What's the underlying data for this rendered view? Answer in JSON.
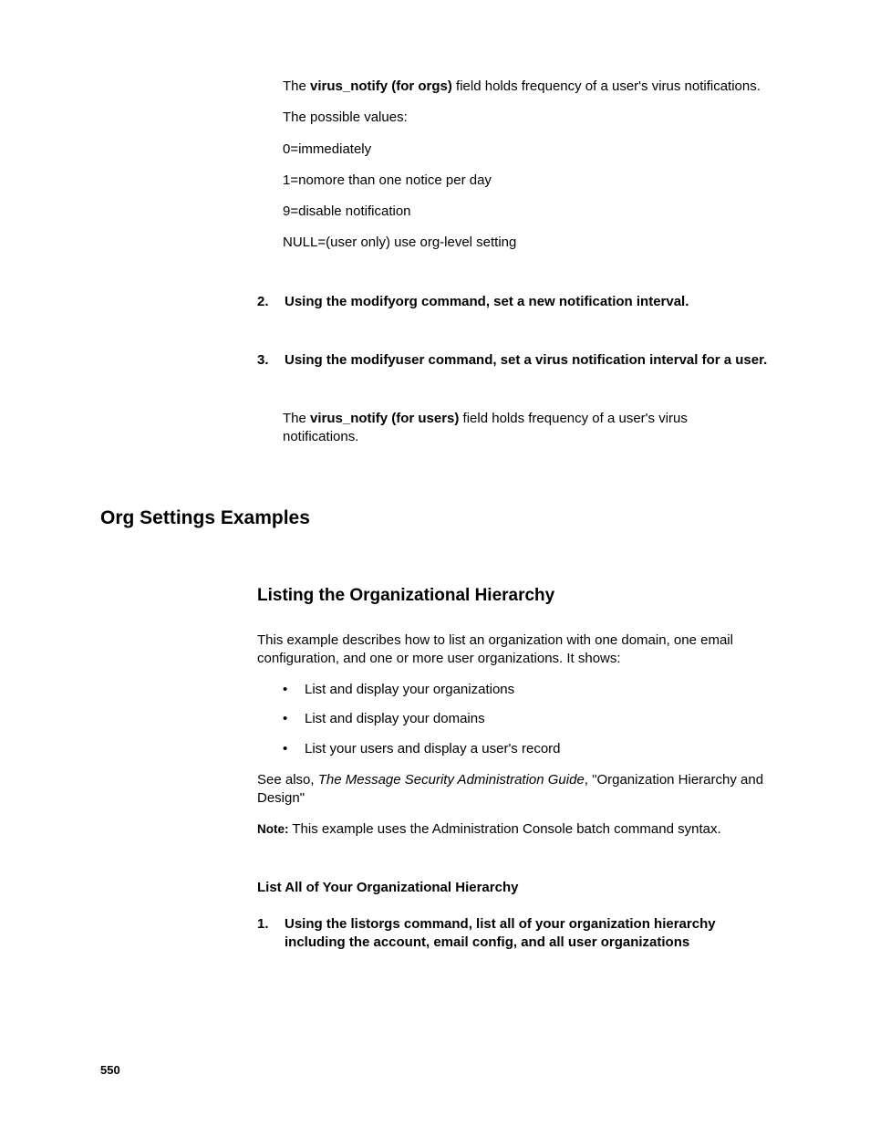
{
  "block1": {
    "p1_pre": "The ",
    "p1_bold": "virus_notify (for orgs)",
    "p1_post": " field holds frequency of a user's virus notifications.",
    "p2": "The possible values:",
    "p3": "0=immediately",
    "p4": "1=nomore than one notice per day",
    "p5": "9=disable notification",
    "p6": "NULL=(user only) use org-level setting"
  },
  "step2": {
    "num": "2.",
    "text": "Using the modifyorg command, set a new notification interval."
  },
  "step3": {
    "num": "3.",
    "text": "Using the modifyuser command, set a virus notification interval for a user."
  },
  "block2": {
    "p1_pre": "The ",
    "p1_bold": "virus_notify (for users)",
    "p1_post": " field holds frequency of a user's virus notifications."
  },
  "h1": "Org Settings Examples",
  "h2": "Listing the Organizational Hierarchy",
  "intro": "This example describes how to list an organization with one domain, one email configuration, and one or more user organizations. It shows:",
  "bullets": [
    "List and display your organizations",
    "List and display your domains",
    "List your users and display a user's record"
  ],
  "seealso_pre": "See also, ",
  "seealso_it": "The Message Security Administration Guide",
  "seealso_post": ", \"Organization Hierarchy and Design\"",
  "note_label": "Note:",
  "note_text": " This example uses the Administration Console batch command syntax.",
  "h3": "List All of Your Organizational Hierarchy",
  "step1b": {
    "num": "1.",
    "text": "Using the listorgs command, list all of your organization hierarchy including the account, email config, and all user organizations"
  },
  "page": "550"
}
